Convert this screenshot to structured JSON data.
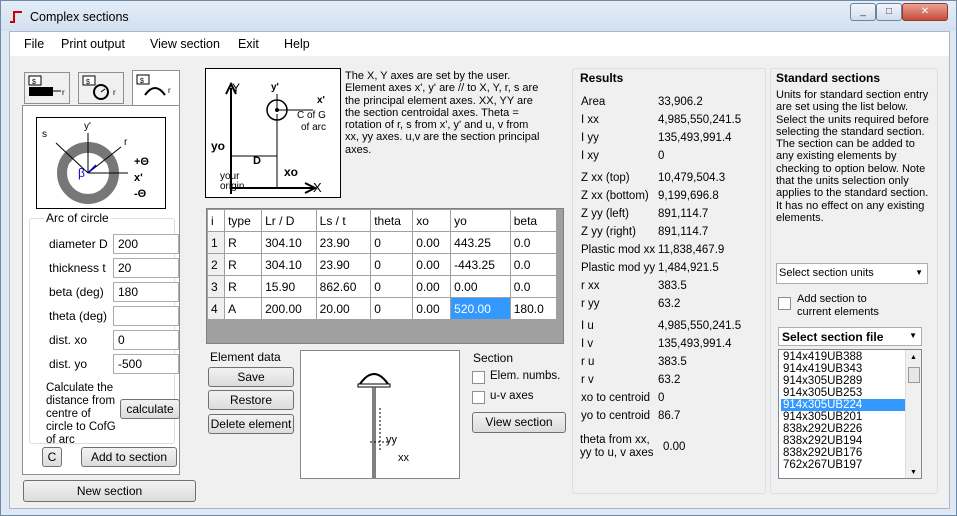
{
  "window": {
    "title": "Complex sections",
    "controls": [
      "_",
      "□",
      "✕"
    ]
  },
  "menu": [
    "File",
    "Print output",
    "View section",
    "Exit",
    "Help"
  ],
  "tabs": [
    "s r",
    "s r",
    "s r"
  ],
  "arc_diagram": {
    "s": "s",
    "y": "y'",
    "r": "r",
    "beta": "β",
    "plus": "+Θ",
    "x": "x'",
    "minus": "-Θ"
  },
  "arc_group": {
    "title": "Arc of circle",
    "fields": [
      {
        "label": "diameter D",
        "value": "200"
      },
      {
        "label": "thickness t",
        "value": "20"
      },
      {
        "label": "beta (deg)",
        "value": "180"
      },
      {
        "label": "theta (deg)",
        "value": ""
      },
      {
        "label": "dist. xo",
        "value": "0"
      },
      {
        "label": "dist. yo",
        "value": "-500"
      }
    ],
    "calc_text": "Calculate the distance from centre of circle to CofG of arc",
    "calculate_btn": "calculate",
    "c_btn": "C",
    "add_btn": "Add to section"
  },
  "new_section_btn": "New section",
  "axes_diagram": {
    "Y": "Y",
    "yo": "yo",
    "y": "y'",
    "x": "x'",
    "cofg": "C of G",
    "ofarc": "of arc",
    "D": "D",
    "X": "X",
    "xo": "xo",
    "your": "your",
    "origin": "origin"
  },
  "description": "The X, Y axes are set by the user. Element axes x', y' are // to X, Y, r, s are the principal element axes. XX, YY are the section centroidal axes. Theta = rotation of r, s from x', y' and u, v from xx, yy axes. u,v are the section principal axes.",
  "table": {
    "headers": [
      "i",
      "type",
      "Lr / D",
      "Ls / t",
      "theta",
      "xo",
      "yo",
      "beta"
    ],
    "rows": [
      [
        "1",
        "R",
        "304.10",
        "23.90",
        "0",
        "0.00",
        "443.25",
        "0.0"
      ],
      [
        "2",
        "R",
        "304.10",
        "23.90",
        "0",
        "0.00",
        "-443.25",
        "0.0"
      ],
      [
        "3",
        "R",
        "15.90",
        "862.60",
        "0",
        "0.00",
        "0.00",
        "0.0"
      ],
      [
        "4",
        "A",
        "200.00",
        "20.00",
        "0",
        "0.00",
        "520.00",
        "180.0"
      ]
    ]
  },
  "element_data": {
    "title": "Element data",
    "save": "Save",
    "restore": "Restore",
    "delete": "Delete element"
  },
  "preview": {
    "yy": "yy",
    "xx": "xx"
  },
  "section_opts": {
    "title": "Section",
    "elem": "Elem. numbs.",
    "uv": "u-v axes",
    "view": "View section"
  },
  "results": {
    "title": "Results",
    "items": [
      {
        "k": "Area",
        "v": "33,906.2"
      },
      {
        "k": "I xx",
        "v": "4,985,550,241.5"
      },
      {
        "k": "I yy",
        "v": "135,493,991.4"
      },
      {
        "k": "I xy",
        "v": "0"
      },
      {
        "k": "Z xx (top)",
        "v": "10,479,504.3"
      },
      {
        "k": "Z xx (bottom)",
        "v": "9,199,696.8"
      },
      {
        "k": "Z yy (left)",
        "v": "891,114.7"
      },
      {
        "k": "Z yy (right)",
        "v": "891,114.7"
      },
      {
        "k": "Plastic mod xx",
        "v": "11,838,467.9"
      },
      {
        "k": "Plastic mod yy",
        "v": "1,484,921.5"
      },
      {
        "k": "r xx",
        "v": "383.5"
      },
      {
        "k": "r yy",
        "v": "63.2"
      },
      {
        "k": "I u",
        "v": "4,985,550,241.5"
      },
      {
        "k": "I v",
        "v": "135,493,991.4"
      },
      {
        "k": "r u",
        "v": "383.5"
      },
      {
        "k": "r v",
        "v": "63.2"
      },
      {
        "k": "xo to centroid",
        "v": "0"
      },
      {
        "k": "yo to centroid",
        "v": "86.7"
      }
    ],
    "theta_label": "theta from xx, yy to u, v axes",
    "theta_val": "0.00"
  },
  "standard": {
    "title": "Standard sections",
    "desc": "Units for standard section entry are set using the list below. Select the units required before selecting the standard section. The section can be added to any existing elements by checking to option below. Note that the units selection only applies to the standard section. It has no effect on any existing elements.",
    "units_placeholder": "Select section units",
    "add_label": "Add section to current elements",
    "file_label": "Select section file",
    "sections": [
      "914x419UB388",
      "914x419UB343",
      "914x305UB289",
      "914x305UB253",
      "914x305UB224",
      "914x305UB201",
      "838x292UB226",
      "838x292UB194",
      "838x292UB176",
      "762x267UB197"
    ],
    "selected_index": 4
  },
  "colors": {
    "selection": "#3399ff",
    "accent": "#cc0000"
  }
}
